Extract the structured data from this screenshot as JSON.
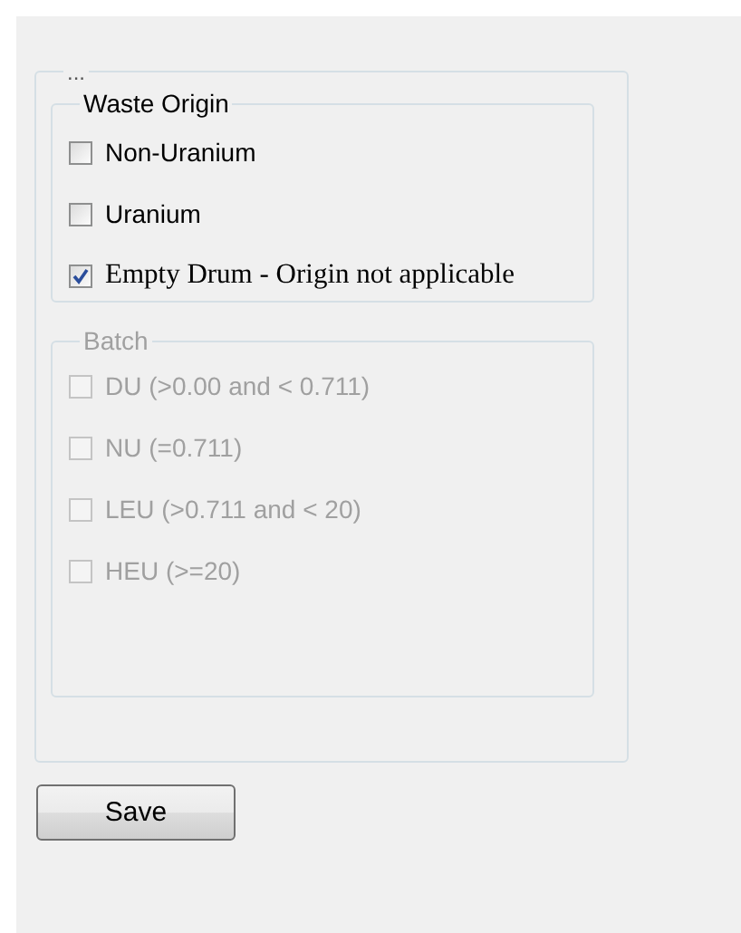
{
  "panel": {
    "title": "...",
    "groups": [
      {
        "title": "Waste Origin",
        "disabled": false,
        "options": [
          {
            "label": "Non-Uranium",
            "checked": false,
            "kind": "sans"
          },
          {
            "label": "Uranium",
            "checked": false,
            "kind": "sans"
          },
          {
            "label": "Empty Drum - Origin not applicable",
            "checked": true,
            "kind": "serif"
          }
        ]
      },
      {
        "title": "Batch",
        "disabled": true,
        "options": [
          {
            "label": "DU (>0.00 and < 0.711)",
            "checked": false,
            "kind": "sans"
          },
          {
            "label": "NU (=0.711)",
            "checked": false,
            "kind": "sans"
          },
          {
            "label": "LEU (>0.711 and < 20)",
            "checked": false,
            "kind": "sans"
          },
          {
            "label": "HEU (>=20)",
            "checked": false,
            "kind": "sans"
          }
        ]
      }
    ]
  },
  "buttons": [
    {
      "label": "Save"
    }
  ]
}
